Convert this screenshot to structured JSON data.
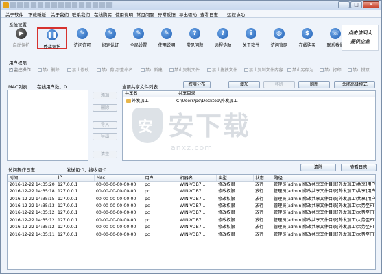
{
  "window": {
    "min": "–",
    "max": "□",
    "close": "✕"
  },
  "menu": [
    "关于软件",
    "下载新版",
    "关于我们",
    "联系我们",
    "在线购买",
    "使用说明",
    "常见问题",
    "异常反馈",
    "导出驱动",
    "查看日志",
    "远程协助"
  ],
  "system_settings": {
    "label": "系统设置",
    "tools": [
      {
        "label": "启动保护",
        "icon": "play-icon"
      },
      {
        "label": "停止保护",
        "icon": "pause-icon"
      },
      {
        "label": "访问许可",
        "icon": "edit-icon"
      },
      {
        "label": "绑定认证",
        "icon": "edit-icon"
      },
      {
        "label": "全局设置",
        "icon": "edit-icon"
      },
      {
        "label": "使用说明",
        "icon": "edit-icon"
      },
      {
        "label": "常见问题",
        "icon": "help-icon"
      },
      {
        "label": "远程协助",
        "icon": "help-icon"
      },
      {
        "label": "关于软件",
        "icon": "info-icon"
      },
      {
        "label": "访问官网",
        "icon": "globe-icon"
      },
      {
        "label": "在线购买",
        "icon": "cart-icon"
      },
      {
        "label": "联系我们",
        "icon": "chat-icon"
      }
    ],
    "brand_lines": [
      "点击访问大",
      "提供企业"
    ]
  },
  "user_permissions": {
    "label": "用户权限",
    "items": [
      {
        "label": "监控操作",
        "checked": true
      },
      {
        "label": "禁止删除",
        "checked": false
      },
      {
        "label": "禁止修改",
        "checked": false
      },
      {
        "label": "禁止剪切/重命名",
        "checked": false
      },
      {
        "label": "禁止新建",
        "checked": false
      },
      {
        "label": "禁止复制文件",
        "checked": false
      },
      {
        "label": "禁止拖拽文件",
        "checked": false
      },
      {
        "label": "禁止复制文件内容",
        "checked": false
      },
      {
        "label": "禁止另存为",
        "checked": false
      },
      {
        "label": "禁止打印",
        "checked": false
      },
      {
        "label": "禁止拔取",
        "checked": false
      }
    ]
  },
  "mac_list": {
    "label": "MAC列表",
    "online_count": "在线用户数：0"
  },
  "mac_buttons": [
    "添加",
    "删除",
    "导入",
    "导出",
    "清空"
  ],
  "shared": {
    "label": "当前共享文件列表",
    "perm_button": "权限分布",
    "add": "增加",
    "remove": "移除",
    "refresh": "刷新",
    "close_adv": "关闭高级模式",
    "columns": [
      "共享名",
      "共享目录"
    ],
    "rows": [
      {
        "name": "外发加工",
        "path": "C:\\Users\\pc\\Desktop\\外发加工"
      }
    ]
  },
  "log": {
    "label": "访问操作日志",
    "stats": "发送包:0，接收包:0",
    "clear": "清除",
    "view": "查看日志",
    "columns": [
      "时间",
      "IP",
      "Mac",
      "用户",
      "机器名",
      "类型",
      "状态",
      "路径"
    ],
    "rows": [
      [
        "2016-12-22 14:35:20",
        "127.0.0.1",
        "00-00-00-00-00-00",
        "pc",
        "WIN-VDB7...",
        "修改权限",
        "放行",
        "管理员[admin]修改共享文件目录[外发加工\\共享]用户["
      ],
      [
        "2016-12-22 14:35:18",
        "127.0.0.1",
        "00-00-00-00-00-00",
        "pc",
        "WIN-VDB7...",
        "修改权限",
        "放行",
        "管理员[admin]修改共享文件目录[外发加工\\共享]用户["
      ],
      [
        "2016-12-22 14:35:15",
        "127.0.0.1",
        "00-00-00-00-00-00",
        "pc",
        "WIN-VDB7...",
        "修改权限",
        "放行",
        "管理员[admin]修改共享文件目录[外发加工\\共享]用户["
      ],
      [
        "2016-12-22 14:35:13",
        "127.0.0.1",
        "00-00-00-00-00-00",
        "pc",
        "WIN-VDB7...",
        "修改权限",
        "放行",
        "管理员[admin]修改共享文件目录[外发加工\\大势至FTP"
      ],
      [
        "2016-12-22 14:35:12",
        "127.0.0.1",
        "00-00-00-00-00-00",
        "pc",
        "WIN-VDB7...",
        "修改权限",
        "放行",
        "管理员[admin]修改共享文件目录[外发加工\\大势至FTP"
      ],
      [
        "2016-12-22 14:35:12",
        "127.0.0.1",
        "00-00-00-00-00-00",
        "pc",
        "WIN-VDB7...",
        "修改权限",
        "放行",
        "管理员[admin]修改共享文件目录[外发加工\\大势至FTP"
      ],
      [
        "2016-12-22 14:35:12",
        "127.0.0.1",
        "00-00-00-00-00-00",
        "pc",
        "WIN-VDB7...",
        "修改权限",
        "放行",
        "管理员[admin]修改共享文件目录[外发加工\\大势至FTP"
      ],
      [
        "2016-12-22 14:35:11",
        "127.0.0.1",
        "00-00-00-00-00-00",
        "pc",
        "WIN-VDB7...",
        "修改权限",
        "放行",
        "管理员[admin]修改共享文件目录[外发加工\\大势至FTP"
      ]
    ]
  },
  "watermark": {
    "big": "安下载",
    "small": "anxz.com"
  }
}
